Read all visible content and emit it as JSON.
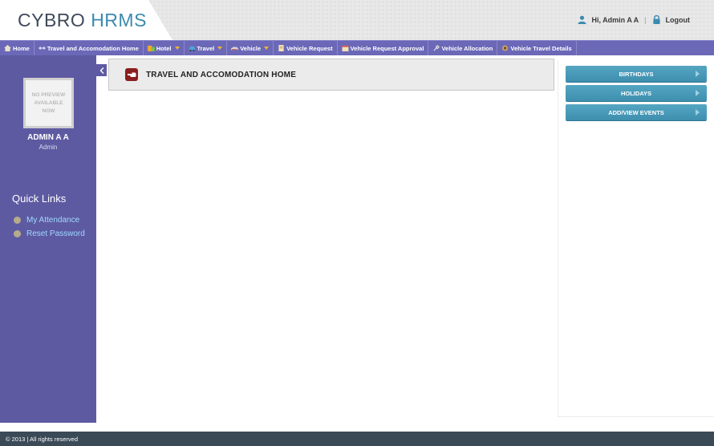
{
  "app": {
    "logo_part1": "CYBRO",
    "logo_part2": "HRMS"
  },
  "user_bar": {
    "greeting": "Hi, Admin A A",
    "separator": "|",
    "logout_label": "Logout"
  },
  "nav": {
    "items": [
      {
        "label": "Home",
        "icon": "home-icon",
        "dropdown": false
      },
      {
        "label": "Travel and Accomodation Home",
        "icon": "arrows-icon",
        "dropdown": false
      },
      {
        "label": "Hotel",
        "icon": "hotel-icon",
        "dropdown": true
      },
      {
        "label": "Travel",
        "icon": "car-icon",
        "dropdown": true
      },
      {
        "label": "Vehicle",
        "icon": "vehicle-icon",
        "dropdown": true
      },
      {
        "label": "Vehicle Request",
        "icon": "document-icon",
        "dropdown": false
      },
      {
        "label": "Vehicle Request Approval",
        "icon": "calendar-icon",
        "dropdown": false
      },
      {
        "label": "Vehicle Allocation",
        "icon": "pin-icon",
        "dropdown": false
      },
      {
        "label": "Vehicle Travel Details",
        "icon": "travel-details-icon",
        "dropdown": false
      }
    ]
  },
  "sidebar": {
    "avatar_text": "NO PREVIEW\nAVAILABLE\nNOW",
    "user_name": "ADMIN A A",
    "user_role": "Admin",
    "quick_links_title": "Quick Links",
    "quick_links": [
      {
        "label": "My Attendance"
      },
      {
        "label": "Reset Password"
      }
    ]
  },
  "main": {
    "title": "TRAVEL AND ACCOMODATION HOME"
  },
  "right_panel": {
    "buttons": [
      {
        "label": "BIRTHDAYS"
      },
      {
        "label": "HOLIDAYS"
      },
      {
        "label": "ADD/VIEW EVENTS"
      }
    ]
  },
  "footer": {
    "text": "© 2013 | All rights reserved"
  },
  "colors": {
    "nav_bg": "#6b68b8",
    "sidebar_bg": "#5e5aa2",
    "accent_blue": "#3b8ab0",
    "button_teal": "#4a9bb8",
    "footer_bg": "#3b4a57",
    "title_icon_red": "#8a1d1d"
  }
}
